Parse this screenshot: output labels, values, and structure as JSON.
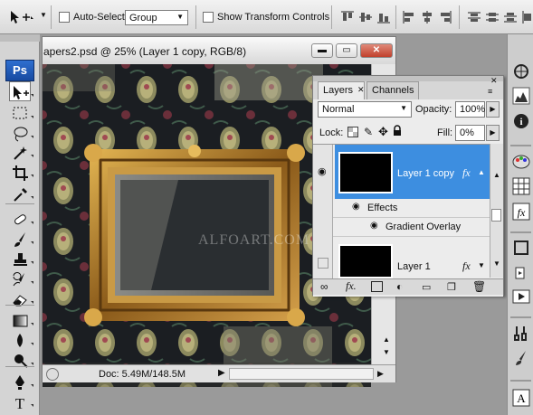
{
  "options_bar": {
    "auto_select_label": "Auto-Select:",
    "auto_select_value": "Group",
    "show_transform_label": "Show Transform Controls"
  },
  "tools": {
    "logo": "Ps",
    "icons": [
      "move-tool-icon",
      "marquee-tool-icon",
      "lasso-tool-icon",
      "magic-wand-icon",
      "crop-tool-icon",
      "eyedropper-icon",
      "healing-brush-icon",
      "brush-tool-icon",
      "clone-stamp-icon",
      "history-brush-icon",
      "eraser-icon",
      "gradient-tool-icon",
      "blur-tool-icon",
      "dodge-tool-icon",
      "pen-tool-icon",
      "type-tool-icon"
    ]
  },
  "document": {
    "title": "apers2.psd @ 25% (Layer 1 copy, RGB/8)",
    "status": "Doc: 5.49M/148.5M",
    "watermark": "ALFOART.COM"
  },
  "layers_panel": {
    "tabs": [
      {
        "label": "Layers"
      },
      {
        "label": "Channels"
      }
    ],
    "blend_mode": "Normal",
    "opacity_label": "Opacity:",
    "opacity_value": "100%",
    "lock_label": "Lock:",
    "fill_label": "Fill:",
    "fill_value": "0%",
    "layers": [
      {
        "name": "Layer 1 copy",
        "fx": "fx",
        "selected": true
      },
      {
        "name": "Layer 1",
        "fx": "fx",
        "selected": false
      }
    ],
    "effects_label": "Effects",
    "gradient_overlay_label": "Gradient Overlay"
  },
  "colors": {
    "selection_blue": "#3d8ee0",
    "wallpaper_dark": "#1c1f22",
    "frame_gold": "#b8892f"
  }
}
